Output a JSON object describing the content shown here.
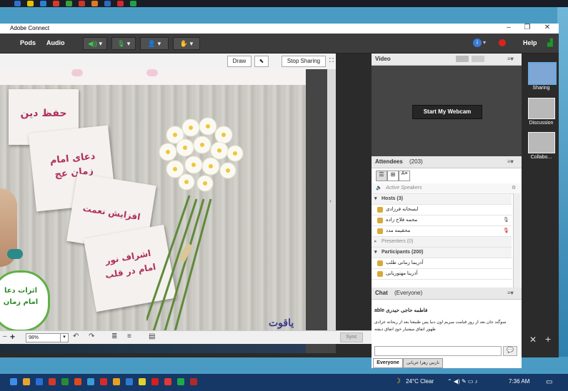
{
  "window": {
    "title": "Adobe Connect",
    "minimize": "–",
    "maximize": "❐",
    "close": "✕"
  },
  "menu": {
    "pods": "Pods",
    "audio": "Audio",
    "help": "Help"
  },
  "share": {
    "draw": "Draw",
    "stop_sharing": "Stop Sharing",
    "zoom_value": "98%",
    "sync": "Sync",
    "slide_cards": [
      "حفظ دین",
      "دعای امام زمان عج",
      "افزایش نعمت",
      "اشراف نور امام در قلب"
    ],
    "slide_bubble": "اثرات دعا امام زمان",
    "slide_logo": "یاقوت"
  },
  "video": {
    "title": "Video",
    "webcam_button": "Start My Webcam"
  },
  "attendees": {
    "title": "Attendees",
    "count": "(203)",
    "active_speakers": "Active Speakers",
    "sections": {
      "hosts": "Hosts (3)",
      "presenters": "Presenters (0)",
      "participants": "Participants (200)"
    },
    "hosts": [
      "ایسحانه فرزادی",
      "محمه فلاح زاده",
      "محقیمه مدد"
    ],
    "participants": [
      "آذریما زمانی طلب",
      "آذرینا مهتوریانی"
    ]
  },
  "chat": {
    "title": "Chat",
    "audience": "(Everyone)",
    "sender": "able فاطمه حاجی حیدری",
    "message": "سوگند جان بعد از روز قیامت میریم اون دنیا پس طبیعتا بعد از ریحانه عرادی ظهور اتفاق میفتیار خودِ اتفاق دیفته",
    "tab_everyone": "Everyone",
    "tab_private": "نازنین زهرا عزیانی",
    "send_icon": "speech-bubble-icon"
  },
  "layouts": [
    {
      "label": "Sharing",
      "active": true
    },
    {
      "label": "Discussion",
      "active": false
    },
    {
      "label": "Collabo...",
      "active": false
    }
  ],
  "taskbar": {
    "weather": "24°C  Clear",
    "time": "7:36 AM"
  },
  "colors": {
    "accent_green": "#1a9a2a",
    "record_red": "#e02020",
    "taskbar": "#163866"
  }
}
